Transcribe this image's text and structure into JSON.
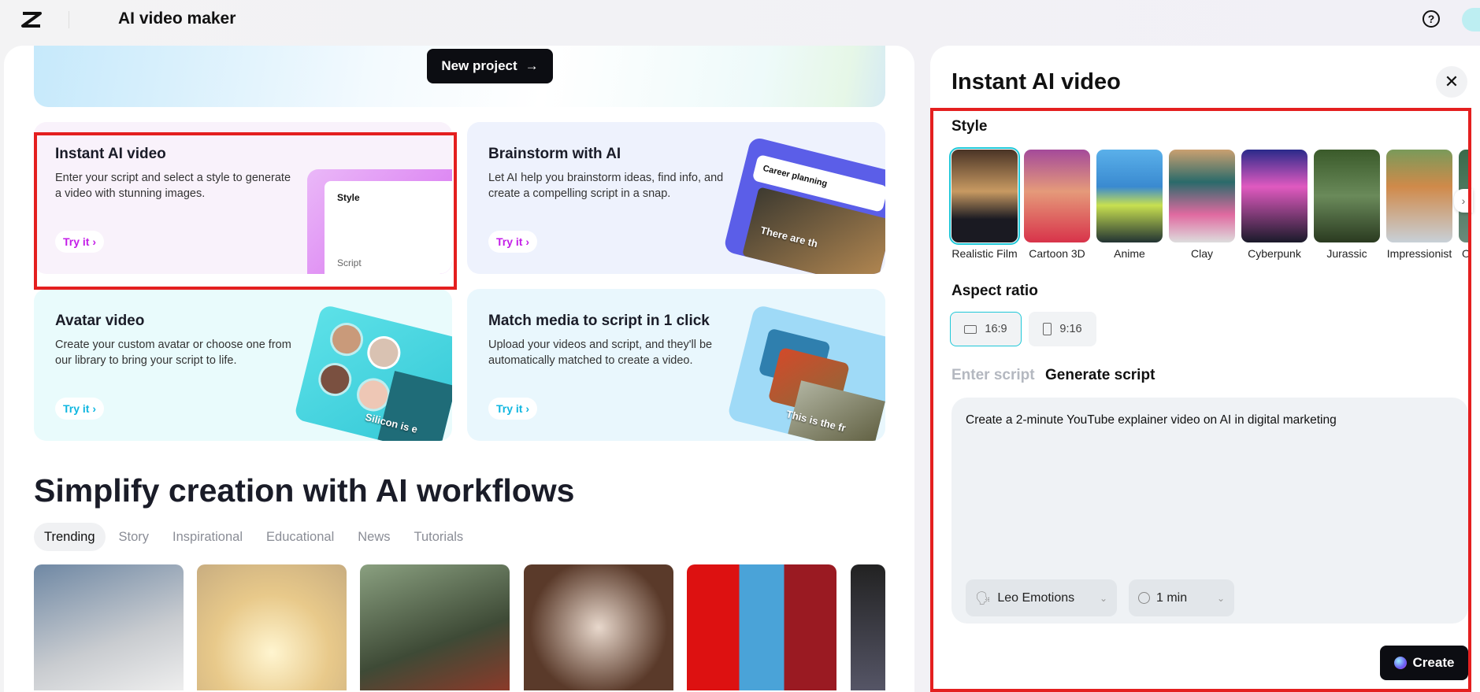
{
  "topbar": {
    "title": "AI video maker",
    "help_icon": "help-circle-icon"
  },
  "banner": {
    "new_project": "New project",
    "arrow": "→"
  },
  "cards": [
    {
      "title": "Instant AI video",
      "desc": "Enter your script and select a style to generate a video with stunning images.",
      "try": "Try it ›",
      "art_style": "Style",
      "art_script": "Script"
    },
    {
      "title": "Brainstorm with AI",
      "desc": "Let AI help you brainstorm ideas, find info, and create a compelling script in a snap.",
      "try": "Try it ›",
      "art_search": "Career planning",
      "art_caption": "There are th"
    },
    {
      "title": "Avatar video",
      "desc": "Create your custom avatar or choose one from our library to bring your script to life.",
      "try": "Try it ›",
      "art_caption": "Silicon is e"
    },
    {
      "title": "Match media to script in 1 click",
      "desc": "Upload your videos and script, and they'll be automatically matched to create a video.",
      "try": "Try it ›",
      "art_caption": "This is the fr"
    }
  ],
  "workflows": {
    "heading": "Simplify creation with AI workflows",
    "tabs": [
      "Trending",
      "Story",
      "Inspirational",
      "Educational",
      "News",
      "Tutorials"
    ],
    "active_tab": "Trending"
  },
  "panel": {
    "title": "Instant AI video",
    "close": "✕",
    "style_label": "Style",
    "styles": [
      "Realistic Film",
      "Cartoon 3D",
      "Anime",
      "Clay",
      "Cyberpunk",
      "Jurassic",
      "Impressionist",
      "O"
    ],
    "selected_style": "Realistic Film",
    "aspect_label": "Aspect ratio",
    "aspects": [
      "16:9",
      "9:16"
    ],
    "selected_aspect": "16:9",
    "script_tabs": [
      "Enter script",
      "Generate script"
    ],
    "active_script_tab": "Generate script",
    "prompt": "Create a 2-minute YouTube explainer video on AI in digital marketing",
    "voice": "Leo Emotions",
    "duration": "1 min",
    "create": "Create"
  },
  "colors": {
    "accent": "#1fc8d8",
    "highlight": "#e41f1f",
    "try_purple": "#c41ee8",
    "try_cyan": "#0fb6e0"
  }
}
